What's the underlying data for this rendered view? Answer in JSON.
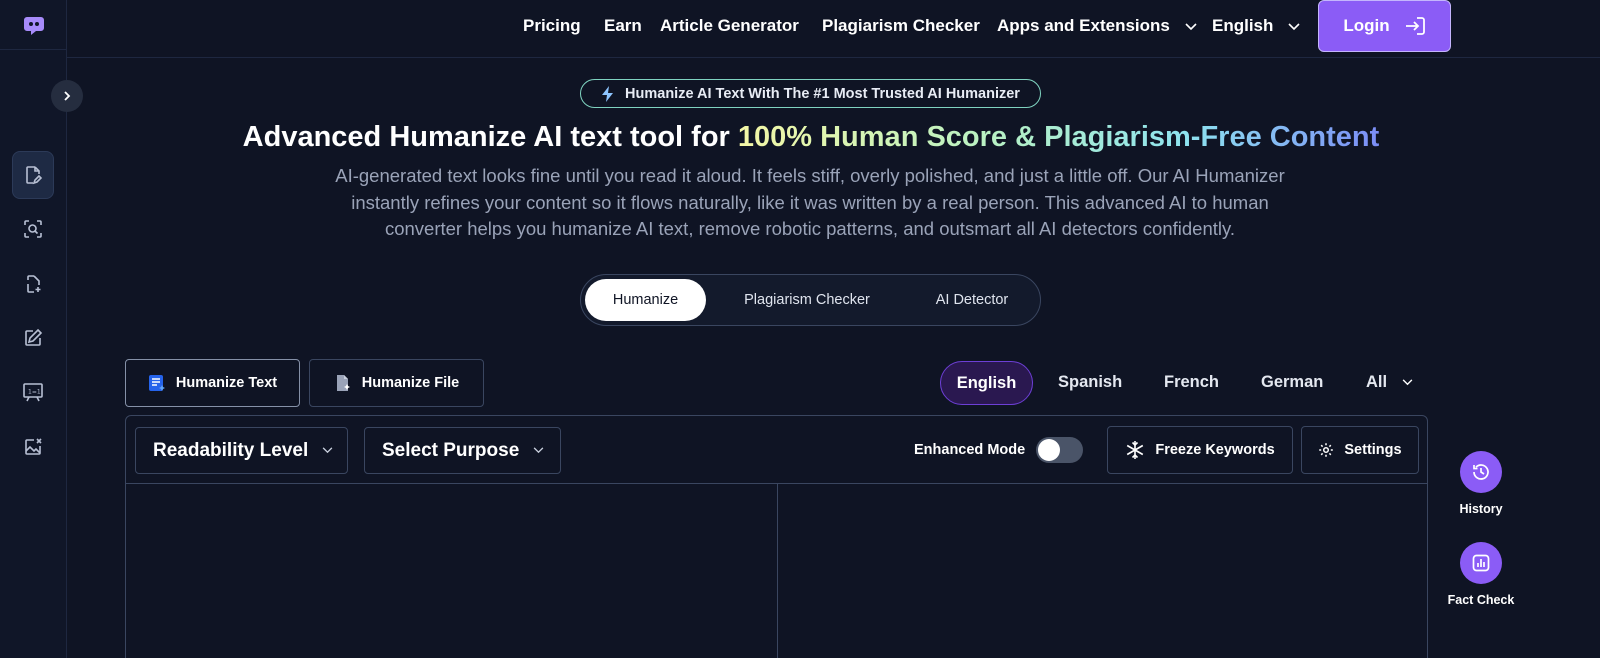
{
  "nav": {
    "items": [
      "Pricing",
      "Earn",
      "Article Generator",
      "Plagiarism Checker"
    ],
    "apps_label": "Apps and Extensions",
    "language_label": "English",
    "login_label": "Login"
  },
  "hero": {
    "badge": "Humanize AI Text With The #1 Most Trusted AI Humanizer",
    "headline_plain": "Advanced Humanize AI text tool for ",
    "headline_highlight": "100% Human Score & Plagiarism-Free Content",
    "subtext_lines": [
      "AI-generated text looks fine until you read it aloud. It feels stiff, overly polished, and just a little off. Our AI Humanizer",
      "instantly refines your content so it flows naturally, like it was written by a real person. This advanced AI to human",
      "converter helps you humanize AI text, remove robotic patterns, and outsmart all AI detectors confidently."
    ]
  },
  "main_tabs": [
    {
      "label": "Humanize",
      "active": true
    },
    {
      "label": "Plagiarism Checker",
      "active": false
    },
    {
      "label": "AI Detector",
      "active": false
    }
  ],
  "mode_tabs": [
    {
      "label": "Humanize Text",
      "active": true
    },
    {
      "label": "Humanize File",
      "active": false
    }
  ],
  "languages": [
    {
      "label": "English",
      "active": true
    },
    {
      "label": "Spanish",
      "active": false
    },
    {
      "label": "French",
      "active": false
    },
    {
      "label": "German",
      "active": false
    },
    {
      "label": "All",
      "active": false
    }
  ],
  "editor": {
    "readability_label": "Readability Level",
    "purpose_label": "Select Purpose",
    "enhanced_mode_label": "Enhanced Mode",
    "enhanced_mode_on": false,
    "freeze_keywords_label": "Freeze Keywords",
    "settings_label": "Settings"
  },
  "floating": {
    "history_label": "History",
    "fact_check_label": "Fact Check"
  },
  "colors": {
    "background": "#0f1424",
    "accent": "#8b5cf6",
    "badge_border": "#7fd3c0",
    "language_active_bg": "#2a1850"
  },
  "icons": {
    "logo": "chat-bubble-logo-icon",
    "rail": [
      "document-edit-icon",
      "scan-search-icon",
      "file-sparkle-icon",
      "pen-edit-icon",
      "compare-board-icon",
      "image-remove-icon"
    ],
    "expand": "chevron-right-icon",
    "badge": "lightning-icon",
    "login": "login-arrow-icon",
    "humanize_text": "text-sparkle-icon",
    "humanize_file": "file-sparkle-icon",
    "freeze": "snowflake-icon",
    "settings": "gear-icon",
    "history": "history-icon",
    "fact_check": "bar-chart-icon"
  }
}
